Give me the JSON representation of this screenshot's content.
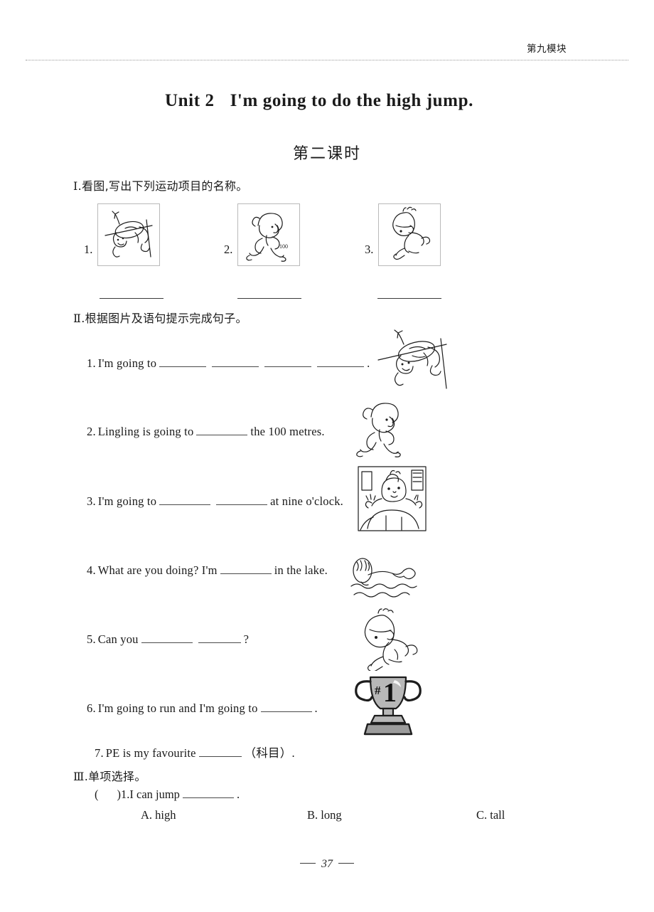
{
  "header": {
    "module_label": "第九模块"
  },
  "title": {
    "unit_prefix": "Unit 2",
    "unit_name": "I'm going to do the high jump.",
    "lesson": "第二课时"
  },
  "sections": [
    {
      "id": "I",
      "roman": "Ⅰ",
      "heading_text": ".看图,写出下列运动项目的名称。",
      "picture_items": [
        {
          "num": "1.",
          "icon": "high-jump-icon",
          "answer_blank": ""
        },
        {
          "num": "2.",
          "icon": "running-icon",
          "label": "100",
          "answer_blank": ""
        },
        {
          "num": "3.",
          "icon": "long-jump-icon",
          "answer_blank": ""
        }
      ]
    },
    {
      "id": "II",
      "roman": "Ⅱ",
      "heading_text": ".根据图片及语句提示完成句子。",
      "questions": [
        {
          "num": "1.",
          "before": "I'm going to",
          "blanks": 4,
          "after": ".",
          "icon": "high-jump-icon"
        },
        {
          "num": "2.",
          "before": "Lingling is going to",
          "blanks": 1,
          "after": "the 100 metres.",
          "icon": "running-icon"
        },
        {
          "num": "3.",
          "before": "I'm going to",
          "blanks": 2,
          "after": "at nine o'clock.",
          "icon": "get-up-bed-icon"
        },
        {
          "num": "4.",
          "before": "What are you doing?  I'm",
          "blanks": 1,
          "after": "in the lake.",
          "icon": "swimming-icon"
        },
        {
          "num": "5.",
          "before": "Can you",
          "blanks": 2,
          "after": "?",
          "icon": "long-jump-icon"
        },
        {
          "num": "6.",
          "before": "I'm going to run and I'm going to",
          "blanks": 1,
          "after": ".",
          "icon": "trophy-icon"
        },
        {
          "num": "7.",
          "before": "PE is my favourite",
          "blanks": 1,
          "after": "（科目）."
        }
      ]
    },
    {
      "id": "III",
      "roman": "Ⅲ",
      "heading_text": ".单项选择。",
      "mc": {
        "bracket_open": "(",
        "bracket_close": ")",
        "num": "1.",
        "stem_before": "I can jump",
        "stem_after": ".",
        "options": [
          {
            "letter": "A.",
            "text": "high"
          },
          {
            "letter": "B.",
            "text": "long"
          },
          {
            "letter": "C.",
            "text": "tall"
          }
        ]
      }
    }
  ],
  "footer": {
    "page_number": "37"
  },
  "illustration_labels": {
    "trophy_rank": "#1",
    "race_distance": "100"
  },
  "colors": {
    "ink": "#1d1d1d",
    "rule": "#9a9a9a",
    "box_border": "#b9b9b9",
    "trophy_fill": "#b5b5b5"
  }
}
